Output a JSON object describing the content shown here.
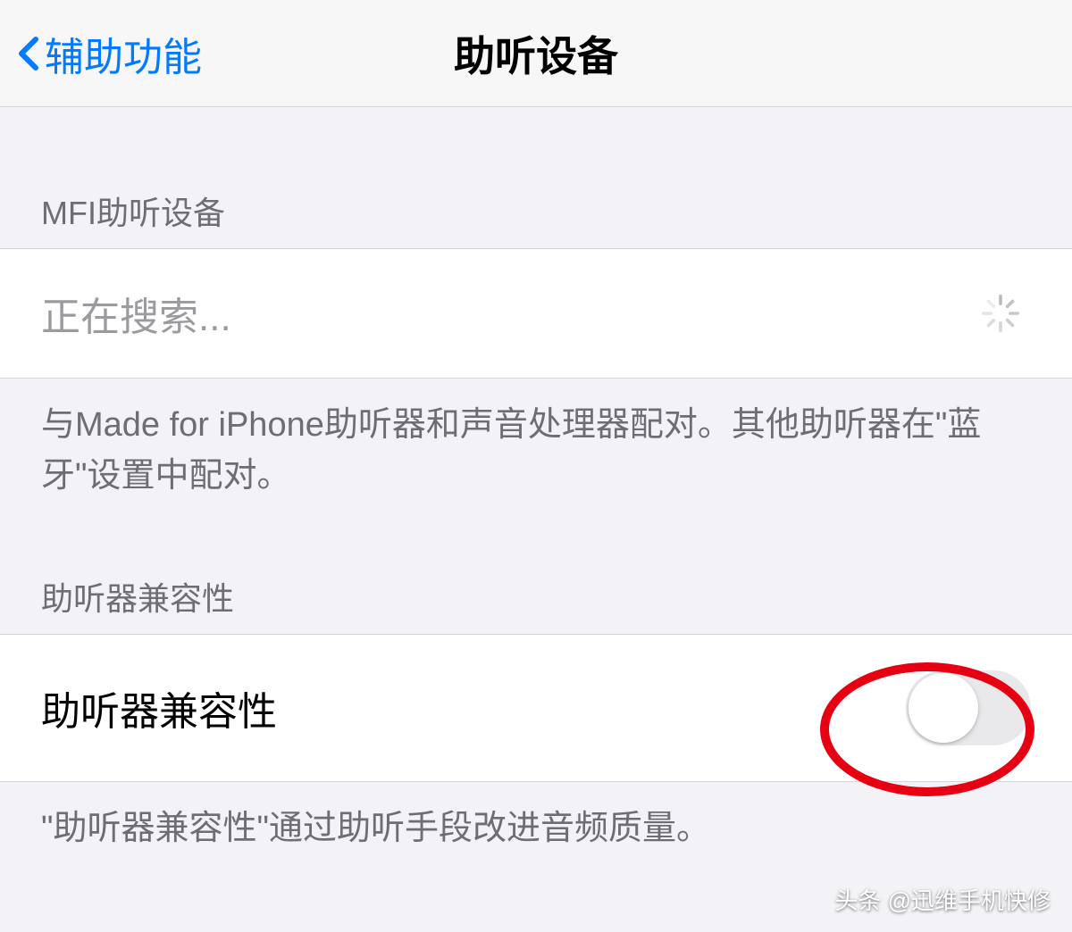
{
  "nav": {
    "back_label": "辅助功能",
    "title": "助听设备"
  },
  "section_mfi": {
    "header": "MFI助听设备",
    "searching_text": "正在搜索...",
    "footer": "与Made for iPhone助听器和声音处理器配对。其他助听器在\"蓝牙\"设置中配对。"
  },
  "section_compat": {
    "header": "助听器兼容性",
    "row_label": "助听器兼容性",
    "toggle_state": "off",
    "footer": "\"助听器兼容性\"通过助听手段改进音频质量。"
  },
  "watermark": "头条 @迅维手机快修"
}
